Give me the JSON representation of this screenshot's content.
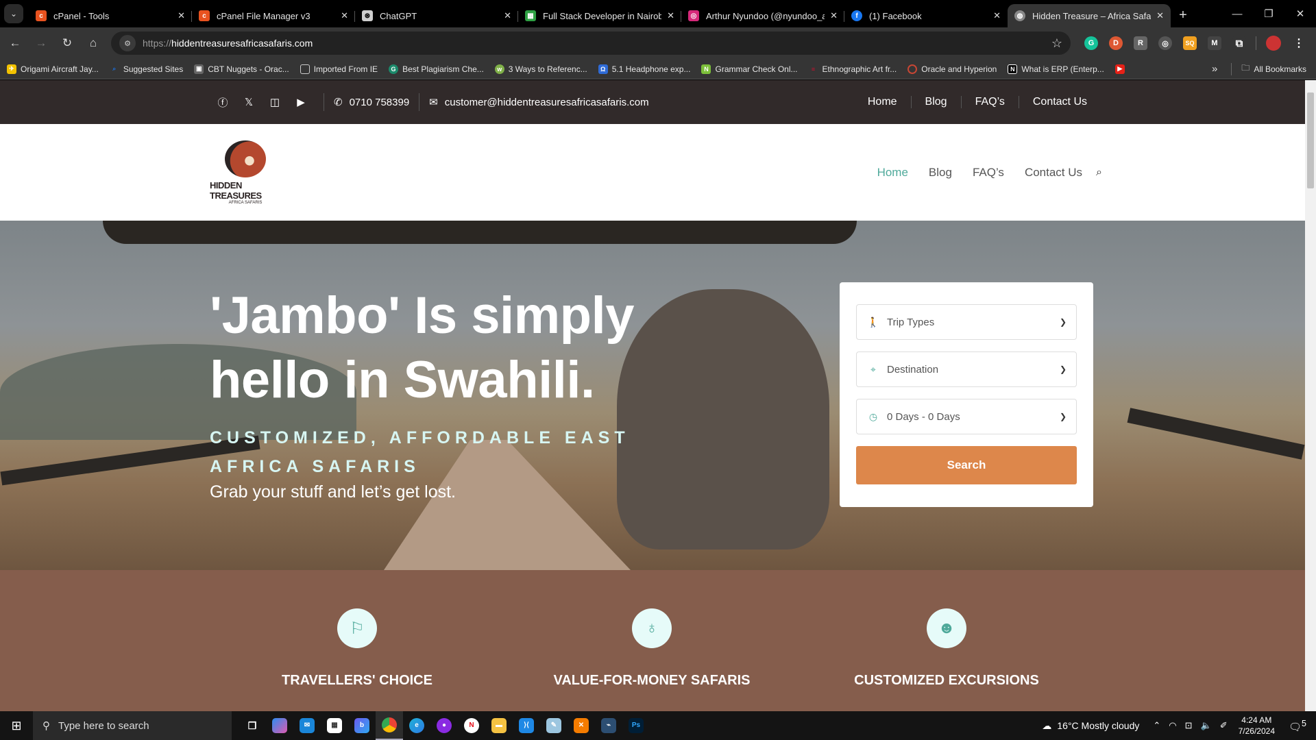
{
  "browser": {
    "tabs": [
      {
        "title": "cPanel - Tools",
        "icon": "cpanel-icon",
        "color": "#e8521f"
      },
      {
        "title": "cPanel File Manager v3",
        "icon": "cpanel-icon",
        "color": "#e8521f"
      },
      {
        "title": "ChatGPT",
        "icon": "chatgpt-icon",
        "color": "#cfcfcf"
      },
      {
        "title": "Full Stack Developer in Nairobi",
        "icon": "sheet-icon",
        "color": "#2ea043"
      },
      {
        "title": "Arthur Nyundoo (@nyundoo_a",
        "icon": "instagram-icon",
        "color": "#d6297a"
      },
      {
        "title": "(1) Facebook",
        "icon": "facebook-icon",
        "color": "#1877f2"
      },
      {
        "title": "Hidden Treasure – Africa Safari",
        "icon": "globe-icon",
        "color": "#888888"
      }
    ],
    "close_glyph": "✕",
    "new_tab_glyph": "+",
    "url_protocol": "https://",
    "url_host": "hiddentreasuresafricasafaris.com",
    "extensions": [
      {
        "name": "grammarly",
        "label": "G",
        "color": "#15c39a"
      },
      {
        "name": "duckduckgo",
        "label": "D",
        "color": "#de5833"
      },
      {
        "name": "reader",
        "label": "R",
        "color": "#666666"
      },
      {
        "name": "target",
        "label": "◎",
        "color": "#555555"
      },
      {
        "name": "sq",
        "label": "SQ",
        "color": "#f0a020"
      },
      {
        "name": "m-ext",
        "label": "M",
        "color": "#444444"
      },
      {
        "name": "extensions",
        "label": "⧉",
        "color": "#353535"
      }
    ],
    "bookmarks": [
      {
        "label": "Origami Aircraft Jay...",
        "color": "#f2c200"
      },
      {
        "label": "Suggested Sites",
        "color": "#1d6ed8"
      },
      {
        "label": "CBT Nuggets - Orac...",
        "color": "#666666"
      },
      {
        "label": "Imported From IE",
        "color": "#555555"
      },
      {
        "label": "Best Plagiarism Che...",
        "color": "#1b8a6b"
      },
      {
        "label": "3 Ways to Referenc...",
        "color": "#7fb048"
      },
      {
        "label": "5.1 Headphone exp...",
        "color": "#2f6bd6"
      },
      {
        "label": "Grammar Check Onl...",
        "color": "#7cbf3a"
      },
      {
        "label": "Ethnographic  Art fr...",
        "color": "#c8102e"
      },
      {
        "label": "Oracle and Hyperion",
        "color": "#c74634"
      },
      {
        "label": "What is ERP (Enterp...",
        "color": "#000000"
      }
    ],
    "overflow": "»",
    "all_bookmarks": "All Bookmarks"
  },
  "site": {
    "topbar": {
      "phone": "0710 758399",
      "email": "customer@hiddentreasuresafricasafaris.com",
      "nav": [
        "Home",
        "Blog",
        "FAQ’s",
        "Contact Us"
      ]
    },
    "logo": {
      "title": "HIDDEN TREASURES",
      "subtitle": "AFRICA SAFARIS"
    },
    "nav": [
      "Home",
      "Blog",
      "FAQ’s",
      "Contact Us"
    ],
    "hero": {
      "headline": "'Jambo' Is simply hello in Swahili.",
      "tagline": "CUSTOMIZED, AFFORDABLE EAST AFRICA SAFARIS",
      "subline": "Grab your stuff and let’s get lost."
    },
    "search_form": {
      "trip_types": "Trip Types",
      "destination": "Destination",
      "duration": "0 Days - 0 Days",
      "button": "Search"
    },
    "features": [
      {
        "title": "TRAVELLERS' CHOICE",
        "icon": "flag-icon"
      },
      {
        "title": "VALUE-FOR-MONEY SAFARIS",
        "icon": "hot-air-balloon-icon"
      },
      {
        "title": "CUSTOMIZED EXCURSIONS",
        "icon": "smiley-icon"
      }
    ],
    "colors": {
      "accent": "#4ea99a",
      "button": "#dd874b",
      "topbar": "#312a2a",
      "features_bg": "#855d4c"
    }
  },
  "taskbar": {
    "search_placeholder": "Type here to search",
    "weather": "16°C  Mostly cloudy",
    "time": "4:24 AM",
    "date": "7/26/2024",
    "notifications": "5"
  }
}
